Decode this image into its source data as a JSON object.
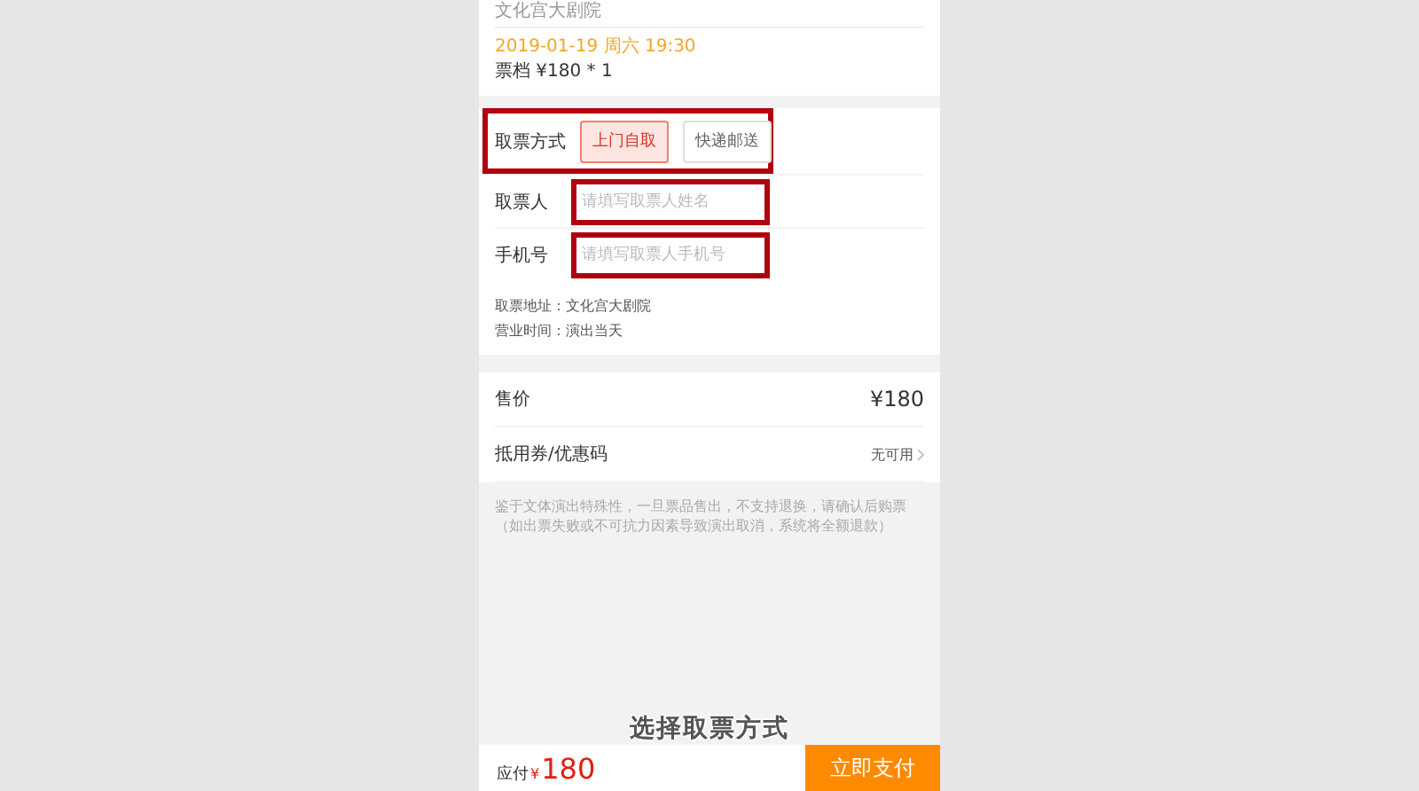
{
  "venue": "文化宫大剧院",
  "show_time": "2019-01-19 周六 19:30",
  "ticket_tier": "票档 ¥180 * 1",
  "pickup": {
    "label": "取票方式",
    "options": [
      {
        "label": "上门自取",
        "selected": true
      },
      {
        "label": "快递邮送",
        "selected": false
      }
    ]
  },
  "fields": [
    {
      "label": "取票人",
      "placeholder": "请填写取票人姓名"
    },
    {
      "label": "手机号",
      "placeholder": "请填写取票人手机号"
    }
  ],
  "info": [
    "取票地址：文化宫大剧院",
    "营业时间：演出当天"
  ],
  "price_rows": [
    {
      "label": "售价",
      "value": "¥180",
      "kind": "price"
    },
    {
      "label": "抵用券/优惠码",
      "value": "无可用",
      "kind": "link"
    }
  ],
  "notice": "鉴于文体演出特殊性，一旦票品售出，不支持退换，请确认后购票（如出票失败或不可抗力因素导致演出取消，系统将全额退款）",
  "caption": "选择取票方式",
  "footer": {
    "due_label": "应付",
    "currency": "¥",
    "amount": "180",
    "pay_button": "立即支付"
  }
}
